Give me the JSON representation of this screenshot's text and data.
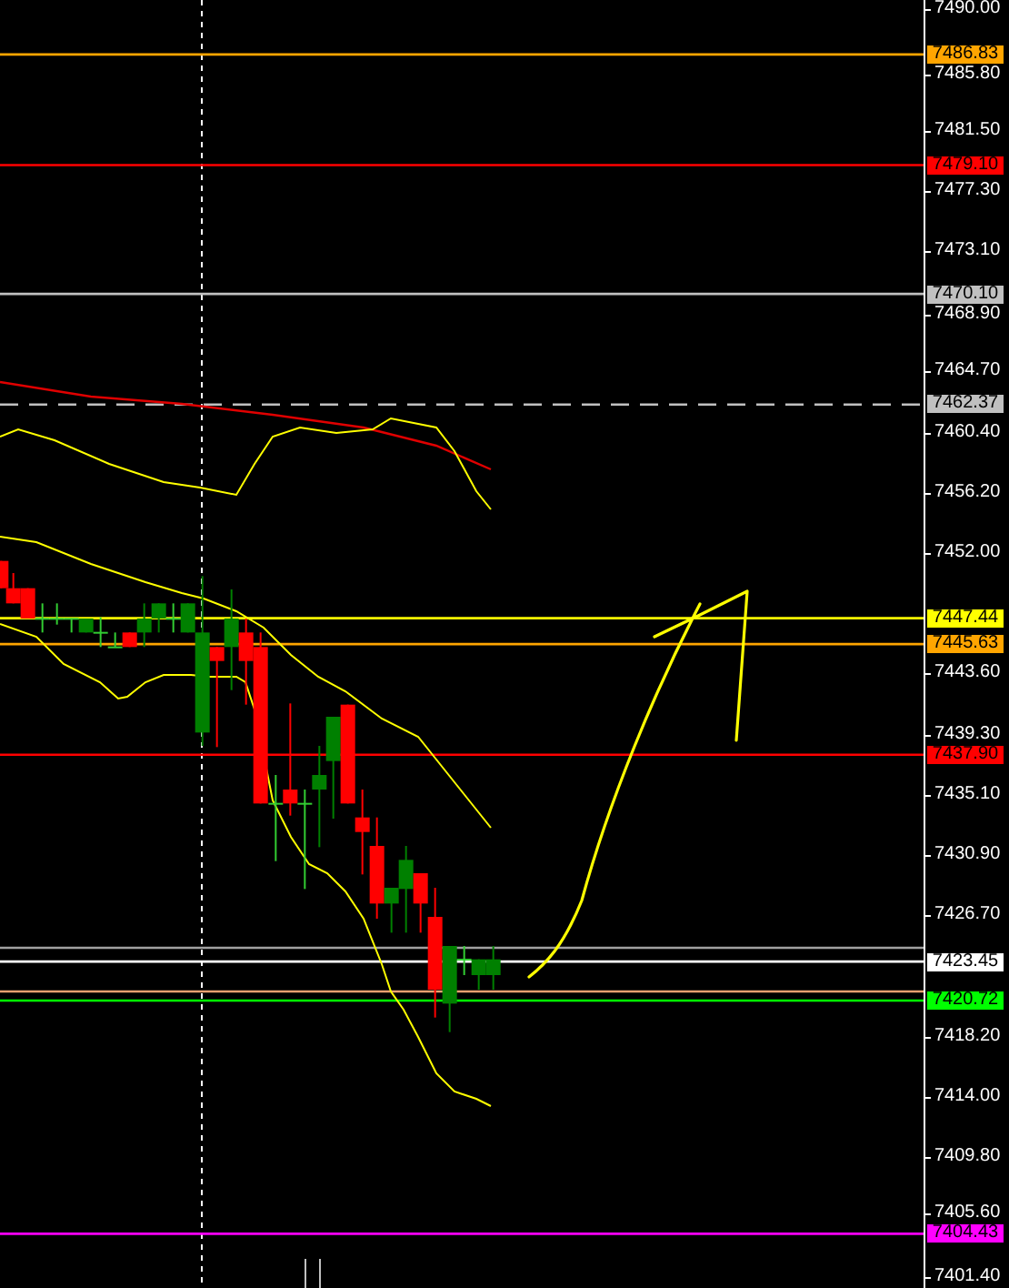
{
  "price_axis": {
    "ticks": [
      "7490.00",
      "7485.80",
      "7481.50",
      "7477.30",
      "7473.10",
      "7468.90",
      "7464.70",
      "7460.40",
      "7456.20",
      "7452.00",
      "7443.60",
      "7439.30",
      "7435.10",
      "7430.90",
      "7426.70",
      "7418.20",
      "7414.00",
      "7409.80",
      "7405.60",
      "7401.40"
    ]
  },
  "levels": [
    {
      "label": "7486.83",
      "color": "#ffa500",
      "kind": "solid"
    },
    {
      "label": "7479.10",
      "color": "#ff0000",
      "kind": "solid"
    },
    {
      "label": "7470.10",
      "color": "#c0c0c0",
      "kind": "solid"
    },
    {
      "label": "7462.37",
      "color": "#c0c0c0",
      "kind": "dashed"
    },
    {
      "label": "7447.44",
      "color": "#ffff00",
      "kind": "solid"
    },
    {
      "label": "7445.63",
      "color": "#ffa500",
      "kind": "solid"
    },
    {
      "label": "7437.90",
      "color": "#ff0000",
      "kind": "solid"
    },
    {
      "label": "7423.45",
      "color": "#ffffff",
      "kind": "solid"
    },
    {
      "label": "7420.72",
      "color": "#00ff00",
      "kind": "solid"
    },
    {
      "label": "7404.43",
      "color": "#ff00ff",
      "kind": "solid"
    }
  ]
}
